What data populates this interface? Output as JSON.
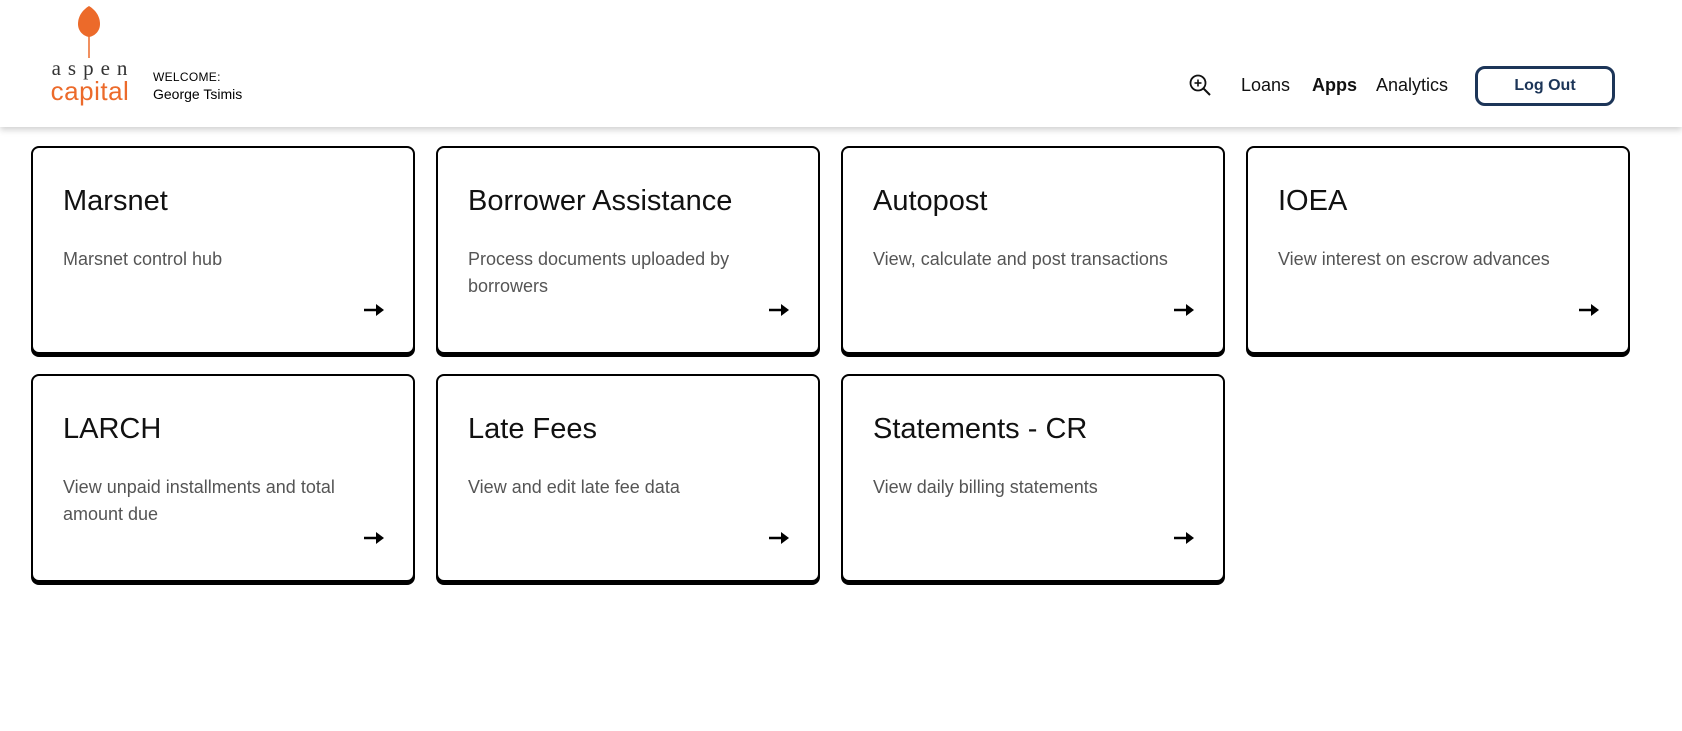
{
  "brand": {
    "logo_top": "aspen",
    "logo_bottom": "capital",
    "accent_color": "#ec6a2a"
  },
  "user": {
    "welcome_label": "WELCOME:",
    "name": "George Tsimis"
  },
  "nav": {
    "search_icon": "zoom-in-icon",
    "links": [
      "Loans",
      "Apps",
      "Analytics"
    ],
    "active": "Apps",
    "logout_label": "Log Out"
  },
  "apps": [
    {
      "title": "Marsnet",
      "description": "Marsnet control hub"
    },
    {
      "title": "Borrower Assistance",
      "description": "Process documents uploaded by borrowers"
    },
    {
      "title": "Autopost",
      "description": "View, calculate and post transactions"
    },
    {
      "title": "IOEA",
      "description": "View interest on escrow advances"
    },
    {
      "title": "LARCH",
      "description": "View unpaid installments and total amount due"
    },
    {
      "title": "Late Fees",
      "description": "View and edit late fee data"
    },
    {
      "title": "Statements - CR",
      "description": "View daily billing statements"
    }
  ]
}
